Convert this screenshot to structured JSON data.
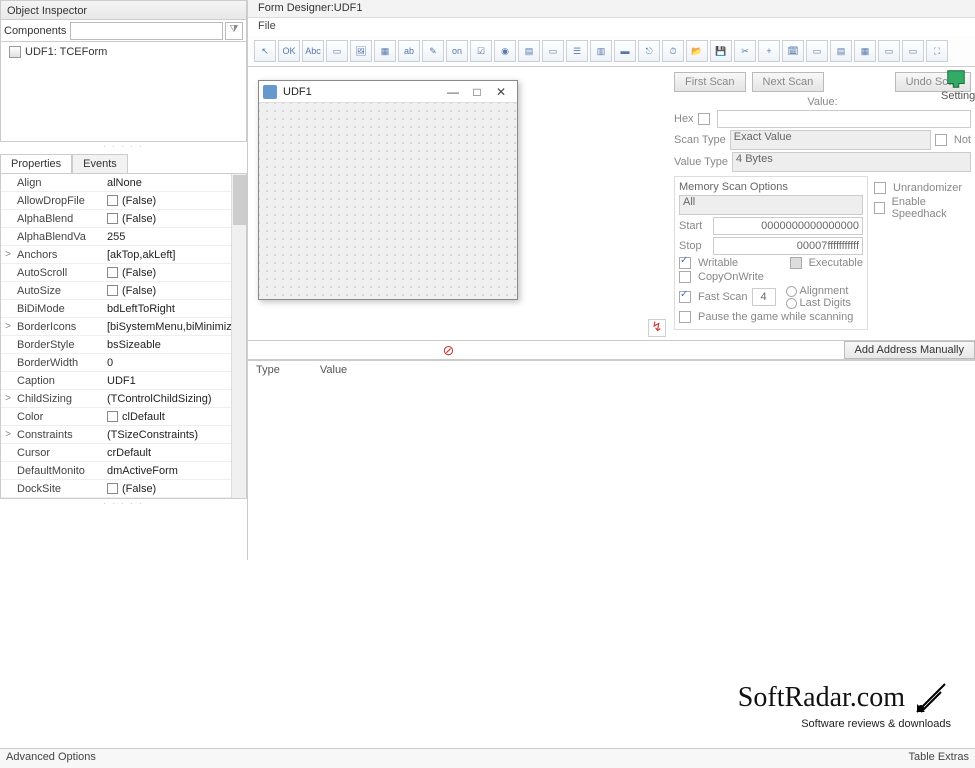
{
  "object_inspector": {
    "title": "Object Inspector",
    "components_label": "Components",
    "tree_item": "UDF1: TCEForm",
    "tabs": {
      "properties": "Properties",
      "events": "Events"
    },
    "props": [
      {
        "exp": "",
        "name": "Align",
        "val": "alNone",
        "chk": false
      },
      {
        "exp": "",
        "name": "AllowDropFile",
        "val": "(False)",
        "chk": true
      },
      {
        "exp": "",
        "name": "AlphaBlend",
        "val": "(False)",
        "chk": true
      },
      {
        "exp": "",
        "name": "AlphaBlendVa",
        "val": "255",
        "chk": false
      },
      {
        "exp": ">",
        "name": "Anchors",
        "val": "[akTop,akLeft]",
        "chk": false
      },
      {
        "exp": "",
        "name": "AutoScroll",
        "val": "(False)",
        "chk": true
      },
      {
        "exp": "",
        "name": "AutoSize",
        "val": "(False)",
        "chk": true
      },
      {
        "exp": "",
        "name": "BiDiMode",
        "val": "bdLeftToRight",
        "chk": false
      },
      {
        "exp": ">",
        "name": "BorderIcons",
        "val": "[biSystemMenu,biMinimize,biM",
        "chk": false
      },
      {
        "exp": "",
        "name": "BorderStyle",
        "val": "bsSizeable",
        "chk": false
      },
      {
        "exp": "",
        "name": "BorderWidth",
        "val": "0",
        "chk": false
      },
      {
        "exp": "",
        "name": "Caption",
        "val": "UDF1",
        "chk": false
      },
      {
        "exp": ">",
        "name": "ChildSizing",
        "val": "(TControlChildSizing)",
        "chk": false
      },
      {
        "exp": "",
        "name": "Color",
        "val": "clDefault",
        "chk": true
      },
      {
        "exp": ">",
        "name": "Constraints",
        "val": "(TSizeConstraints)",
        "chk": false
      },
      {
        "exp": "",
        "name": "Cursor",
        "val": "crDefault",
        "chk": false
      },
      {
        "exp": "",
        "name": "DefaultMonito",
        "val": "dmActiveForm",
        "chk": false
      },
      {
        "exp": "",
        "name": "DockSite",
        "val": "(False)",
        "chk": true
      }
    ]
  },
  "form_designer": {
    "title": "Form Designer:UDF1",
    "menu_file": "File",
    "window_caption": "UDF1"
  },
  "scan": {
    "first_scan": "First Scan",
    "next_scan": "Next Scan",
    "undo_scan": "Undo Scan",
    "settings_label": "Settings",
    "value_label": "Value:",
    "hex_label": "Hex",
    "scan_type_label": "Scan Type",
    "scan_type_val": "Exact Value",
    "not_label": "Not",
    "value_type_label": "Value Type",
    "value_type_val": "4 Bytes",
    "mso_title": "Memory Scan Options",
    "mso_all": "All",
    "start_label": "Start",
    "start_val": "0000000000000000",
    "stop_label": "Stop",
    "stop_val": "00007fffffffffff",
    "writable": "Writable",
    "executable": "Executable",
    "copyonwrite": "CopyOnWrite",
    "fast_scan": "Fast Scan",
    "fast_scan_val": "4",
    "alignment": "Alignment",
    "last_digits": "Last Digits",
    "unrandomizer": "Unrandomizer",
    "enable_speedhack": "Enable Speedhack",
    "pause_game": "Pause the game while scanning",
    "add_manual": "Add Address Manually"
  },
  "results": {
    "type_col": "Type",
    "value_col": "Value"
  },
  "footer": {
    "brand": "SoftRadar.com",
    "tagline": "Software reviews & downloads",
    "left": "Advanced Options",
    "right": "Table Extras"
  }
}
